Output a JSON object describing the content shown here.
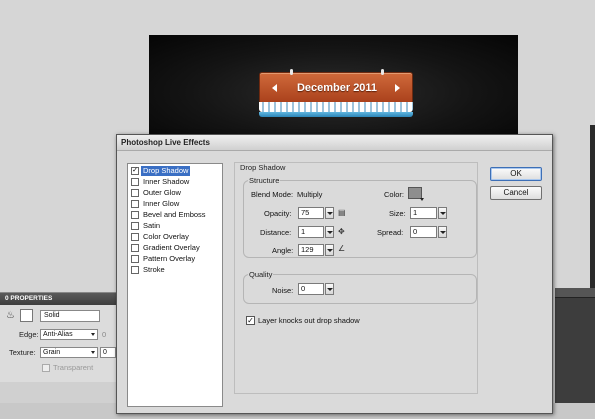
{
  "artboard": {
    "calendar_title": "December 2011"
  },
  "properties_panel": {
    "title": "0 PROPERTIES",
    "style_value": "Solid",
    "edge_label": "Edge:",
    "edge_value": "Anti-Alias",
    "edge_number": "0",
    "texture_label": "Texture:",
    "texture_value": "Grain",
    "texture_number": "0",
    "transparent_label": "Transparent"
  },
  "dialog": {
    "title": "Photoshop Live Effects",
    "effects": [
      {
        "label": "Drop Shadow",
        "checked": true,
        "selected": true
      },
      {
        "label": "Inner Shadow",
        "checked": false,
        "selected": false
      },
      {
        "label": "Outer Glow",
        "checked": false,
        "selected": false
      },
      {
        "label": "Inner Glow",
        "checked": false,
        "selected": false
      },
      {
        "label": "Bevel and Emboss",
        "checked": false,
        "selected": false
      },
      {
        "label": "Satin",
        "checked": false,
        "selected": false
      },
      {
        "label": "Color Overlay",
        "checked": false,
        "selected": false
      },
      {
        "label": "Gradient Overlay",
        "checked": false,
        "selected": false
      },
      {
        "label": "Pattern Overlay",
        "checked": false,
        "selected": false
      },
      {
        "label": "Stroke",
        "checked": false,
        "selected": false
      }
    ],
    "group_title": "Drop Shadow",
    "structure": {
      "title": "Structure",
      "blend_mode_label": "Blend Mode:",
      "blend_mode_value": "Multiply",
      "color_label": "Color:",
      "color_value": "#8e8e8e",
      "opacity_label": "Opacity:",
      "opacity_value": "75",
      "size_label": "Size:",
      "size_value": "1",
      "distance_label": "Distance:",
      "distance_value": "1",
      "spread_label": "Spread:",
      "spread_value": "0",
      "angle_label": "Angle:",
      "angle_value": "129"
    },
    "quality": {
      "title": "Quality",
      "noise_label": "Noise:",
      "noise_value": "0"
    },
    "knockout_label": "Layer knocks out drop shadow",
    "knockout_checked": true,
    "ok_label": "OK",
    "cancel_label": "Cancel"
  },
  "check_glyph": "✓"
}
